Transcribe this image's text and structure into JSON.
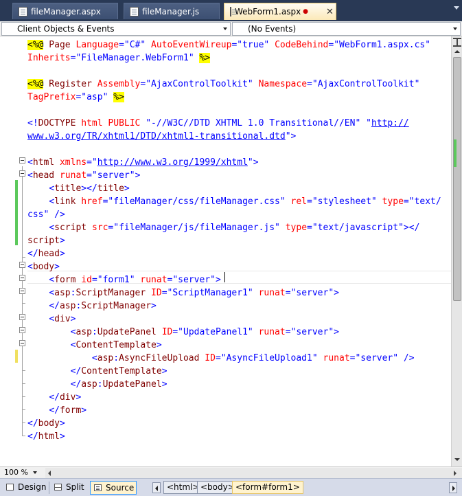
{
  "tabs": [
    {
      "label": "fileManager.aspx",
      "active": false
    },
    {
      "label": "fileManager.js",
      "active": false
    },
    {
      "label": "WebForm1.aspx",
      "active": true,
      "dirty_marker": "●",
      "close": "✕"
    }
  ],
  "navbar": {
    "objects_combo": "Client Objects & Events",
    "events_combo": "(No Events)"
  },
  "code_lines": [
    {
      "segs": [
        {
          "t": "<%@",
          "c": "dir"
        },
        {
          "t": " Page ",
          "c": "asp"
        },
        {
          "t": "Language",
          "c": "attr"
        },
        {
          "t": "=",
          "c": "blue"
        },
        {
          "t": "\"C#\"",
          "c": "val"
        },
        {
          "t": " ",
          "c": ""
        },
        {
          "t": "AutoEventWireup",
          "c": "attr"
        },
        {
          "t": "=",
          "c": "blue"
        },
        {
          "t": "\"true\"",
          "c": "val"
        },
        {
          "t": " ",
          "c": ""
        },
        {
          "t": "CodeBehind",
          "c": "attr"
        },
        {
          "t": "=",
          "c": "blue"
        },
        {
          "t": "\"WebForm1.aspx.cs\"",
          "c": "val"
        }
      ]
    },
    {
      "segs": [
        {
          "t": "Inherits",
          "c": "attr"
        },
        {
          "t": "=",
          "c": "blue"
        },
        {
          "t": "\"FileManager.WebForm1\"",
          "c": "val"
        },
        {
          "t": " ",
          "c": ""
        },
        {
          "t": "%>",
          "c": "dir"
        }
      ]
    },
    {
      "segs": []
    },
    {
      "segs": [
        {
          "t": "<%@",
          "c": "dir"
        },
        {
          "t": " Register ",
          "c": "asp"
        },
        {
          "t": "Assembly",
          "c": "attr"
        },
        {
          "t": "=",
          "c": "blue"
        },
        {
          "t": "\"AjaxControlToolkit\"",
          "c": "val"
        },
        {
          "t": " ",
          "c": ""
        },
        {
          "t": "Namespace",
          "c": "attr"
        },
        {
          "t": "=",
          "c": "blue"
        },
        {
          "t": "\"AjaxControlToolkit\"",
          "c": "val"
        }
      ]
    },
    {
      "segs": [
        {
          "t": "TagPrefix",
          "c": "attr"
        },
        {
          "t": "=",
          "c": "blue"
        },
        {
          "t": "\"asp\"",
          "c": "val"
        },
        {
          "t": " ",
          "c": ""
        },
        {
          "t": "%>",
          "c": "dir"
        }
      ]
    },
    {
      "segs": []
    },
    {
      "segs": [
        {
          "t": "<!",
          "c": "blue"
        },
        {
          "t": "DOCTYPE",
          "c": "asp"
        },
        {
          "t": " ",
          "c": ""
        },
        {
          "t": "html",
          "c": "attr"
        },
        {
          "t": " ",
          "c": ""
        },
        {
          "t": "PUBLIC",
          "c": "attr"
        },
        {
          "t": " ",
          "c": ""
        },
        {
          "t": "\"-//W3C//DTD XHTML 1.0 Transitional//EN\"",
          "c": "val"
        },
        {
          "t": " ",
          "c": ""
        },
        {
          "t": "\"",
          "c": "val"
        },
        {
          "t": "http://",
          "c": "link"
        }
      ]
    },
    {
      "segs": [
        {
          "t": "www.w3.org/TR/xhtml1/DTD/xhtml1-transitional.dtd",
          "c": "link"
        },
        {
          "t": "\"",
          "c": "val"
        },
        {
          "t": ">",
          "c": "blue"
        }
      ]
    },
    {
      "segs": []
    },
    {
      "segs": [
        {
          "t": "<",
          "c": "blue"
        },
        {
          "t": "html",
          "c": "asp"
        },
        {
          "t": " ",
          "c": ""
        },
        {
          "t": "xmlns",
          "c": "attr"
        },
        {
          "t": "=",
          "c": "blue"
        },
        {
          "t": "\"",
          "c": "val"
        },
        {
          "t": "http://www.w3.org/1999/xhtml",
          "c": "link"
        },
        {
          "t": "\"",
          "c": "val"
        },
        {
          "t": ">",
          "c": "blue"
        }
      ]
    },
    {
      "segs": [
        {
          "t": "<",
          "c": "blue"
        },
        {
          "t": "head",
          "c": "asp"
        },
        {
          "t": " ",
          "c": ""
        },
        {
          "t": "runat",
          "c": "attr"
        },
        {
          "t": "=",
          "c": "blue"
        },
        {
          "t": "\"server\"",
          "c": "val"
        },
        {
          "t": ">",
          "c": "blue"
        }
      ]
    },
    {
      "segs": [
        {
          "t": "    ",
          "c": ""
        },
        {
          "t": "<",
          "c": "blue"
        },
        {
          "t": "title",
          "c": "asp"
        },
        {
          "t": "></",
          "c": "blue"
        },
        {
          "t": "title",
          "c": "asp"
        },
        {
          "t": ">",
          "c": "blue"
        }
      ]
    },
    {
      "segs": [
        {
          "t": "    ",
          "c": ""
        },
        {
          "t": "<",
          "c": "blue"
        },
        {
          "t": "link",
          "c": "asp"
        },
        {
          "t": " ",
          "c": ""
        },
        {
          "t": "href",
          "c": "attr"
        },
        {
          "t": "=",
          "c": "blue"
        },
        {
          "t": "\"fileManager/css/fileManager.css\"",
          "c": "val"
        },
        {
          "t": " ",
          "c": ""
        },
        {
          "t": "rel",
          "c": "attr"
        },
        {
          "t": "=",
          "c": "blue"
        },
        {
          "t": "\"stylesheet\"",
          "c": "val"
        },
        {
          "t": " ",
          "c": ""
        },
        {
          "t": "type",
          "c": "attr"
        },
        {
          "t": "=",
          "c": "blue"
        },
        {
          "t": "\"text/",
          "c": "val"
        }
      ]
    },
    {
      "segs": [
        {
          "t": "css\"",
          "c": "val"
        },
        {
          "t": " />",
          "c": "blue"
        }
      ]
    },
    {
      "segs": [
        {
          "t": "    ",
          "c": ""
        },
        {
          "t": "<",
          "c": "blue"
        },
        {
          "t": "script",
          "c": "asp"
        },
        {
          "t": " ",
          "c": ""
        },
        {
          "t": "src",
          "c": "attr"
        },
        {
          "t": "=",
          "c": "blue"
        },
        {
          "t": "\"fileManager/js/fileManager.js\"",
          "c": "val"
        },
        {
          "t": " ",
          "c": ""
        },
        {
          "t": "type",
          "c": "attr"
        },
        {
          "t": "=",
          "c": "blue"
        },
        {
          "t": "\"text/javascript\"",
          "c": "val"
        },
        {
          "t": "></",
          "c": "blue"
        }
      ]
    },
    {
      "segs": [
        {
          "t": "script",
          "c": "asp"
        },
        {
          "t": ">",
          "c": "blue"
        }
      ]
    },
    {
      "segs": [
        {
          "t": "</",
          "c": "blue"
        },
        {
          "t": "head",
          "c": "asp"
        },
        {
          "t": ">",
          "c": "blue"
        }
      ]
    },
    {
      "segs": [
        {
          "t": "<",
          "c": "blue"
        },
        {
          "t": "body",
          "c": "asp"
        },
        {
          "t": ">",
          "c": "blue"
        }
      ]
    },
    {
      "segs": [
        {
          "t": "    ",
          "c": ""
        },
        {
          "t": "<",
          "c": "blue"
        },
        {
          "t": "form",
          "c": "asp"
        },
        {
          "t": " ",
          "c": ""
        },
        {
          "t": "id",
          "c": "attr"
        },
        {
          "t": "=",
          "c": "blue"
        },
        {
          "t": "\"form1\"",
          "c": "val"
        },
        {
          "t": " ",
          "c": ""
        },
        {
          "t": "runat",
          "c": "attr"
        },
        {
          "t": "=",
          "c": "blue"
        },
        {
          "t": "\"server\"",
          "c": "val"
        },
        {
          "t": ">",
          "c": "blue"
        }
      ]
    },
    {
      "segs": [
        {
          "t": "    ",
          "c": ""
        },
        {
          "t": "<",
          "c": "blue"
        },
        {
          "t": "asp",
          "c": "asp"
        },
        {
          "t": ":",
          "c": "blue"
        },
        {
          "t": "ScriptManager",
          "c": "asp"
        },
        {
          "t": " ",
          "c": ""
        },
        {
          "t": "ID",
          "c": "attr"
        },
        {
          "t": "=",
          "c": "blue"
        },
        {
          "t": "\"ScriptManager1\"",
          "c": "val"
        },
        {
          "t": " ",
          "c": ""
        },
        {
          "t": "runat",
          "c": "attr"
        },
        {
          "t": "=",
          "c": "blue"
        },
        {
          "t": "\"server\"",
          "c": "val"
        },
        {
          "t": ">",
          "c": "blue"
        }
      ]
    },
    {
      "segs": [
        {
          "t": "    ",
          "c": ""
        },
        {
          "t": "</",
          "c": "blue"
        },
        {
          "t": "asp",
          "c": "asp"
        },
        {
          "t": ":",
          "c": "blue"
        },
        {
          "t": "ScriptManager",
          "c": "asp"
        },
        {
          "t": ">",
          "c": "blue"
        }
      ]
    },
    {
      "segs": [
        {
          "t": "    ",
          "c": ""
        },
        {
          "t": "<",
          "c": "blue"
        },
        {
          "t": "div",
          "c": "asp"
        },
        {
          "t": ">",
          "c": "blue"
        }
      ]
    },
    {
      "segs": [
        {
          "t": "        ",
          "c": ""
        },
        {
          "t": "<",
          "c": "blue"
        },
        {
          "t": "asp",
          "c": "asp"
        },
        {
          "t": ":",
          "c": "blue"
        },
        {
          "t": "UpdatePanel",
          "c": "asp"
        },
        {
          "t": " ",
          "c": ""
        },
        {
          "t": "ID",
          "c": "attr"
        },
        {
          "t": "=",
          "c": "blue"
        },
        {
          "t": "\"UpdatePanel1\"",
          "c": "val"
        },
        {
          "t": " ",
          "c": ""
        },
        {
          "t": "runat",
          "c": "attr"
        },
        {
          "t": "=",
          "c": "blue"
        },
        {
          "t": "\"server\"",
          "c": "val"
        },
        {
          "t": ">",
          "c": "blue"
        }
      ]
    },
    {
      "segs": [
        {
          "t": "        ",
          "c": ""
        },
        {
          "t": "<",
          "c": "blue"
        },
        {
          "t": "ContentTemplate",
          "c": "asp"
        },
        {
          "t": ">",
          "c": "blue"
        }
      ]
    },
    {
      "segs": [
        {
          "t": "            ",
          "c": ""
        },
        {
          "t": "<",
          "c": "blue"
        },
        {
          "t": "asp",
          "c": "asp"
        },
        {
          "t": ":",
          "c": "blue"
        },
        {
          "t": "AsyncFileUpload",
          "c": "asp"
        },
        {
          "t": " ",
          "c": ""
        },
        {
          "t": "ID",
          "c": "attr"
        },
        {
          "t": "=",
          "c": "blue"
        },
        {
          "t": "\"AsyncFileUpload1\"",
          "c": "val"
        },
        {
          "t": " ",
          "c": ""
        },
        {
          "t": "runat",
          "c": "attr"
        },
        {
          "t": "=",
          "c": "blue"
        },
        {
          "t": "\"server\"",
          "c": "val"
        },
        {
          "t": " />",
          "c": "blue"
        }
      ]
    },
    {
      "segs": [
        {
          "t": "        ",
          "c": ""
        },
        {
          "t": "</",
          "c": "blue"
        },
        {
          "t": "ContentTemplate",
          "c": "asp"
        },
        {
          "t": ">",
          "c": "blue"
        }
      ]
    },
    {
      "segs": [
        {
          "t": "        ",
          "c": ""
        },
        {
          "t": "</",
          "c": "blue"
        },
        {
          "t": "asp",
          "c": "asp"
        },
        {
          "t": ":",
          "c": "blue"
        },
        {
          "t": "UpdatePanel",
          "c": "asp"
        },
        {
          "t": ">",
          "c": "blue"
        }
      ]
    },
    {
      "segs": [
        {
          "t": "    ",
          "c": ""
        },
        {
          "t": "</",
          "c": "blue"
        },
        {
          "t": "div",
          "c": "asp"
        },
        {
          "t": ">",
          "c": "blue"
        }
      ]
    },
    {
      "segs": [
        {
          "t": "    ",
          "c": ""
        },
        {
          "t": "</",
          "c": "blue"
        },
        {
          "t": "form",
          "c": "asp"
        },
        {
          "t": ">",
          "c": "blue"
        }
      ]
    },
    {
      "segs": [
        {
          "t": "</",
          "c": "blue"
        },
        {
          "t": "body",
          "c": "asp"
        },
        {
          "t": ">",
          "c": "blue"
        }
      ]
    },
    {
      "segs": [
        {
          "t": "</",
          "c": "blue"
        },
        {
          "t": "html",
          "c": "asp"
        },
        {
          "t": ">",
          "c": "blue"
        }
      ]
    }
  ],
  "zoom": {
    "value": "100 %"
  },
  "view_buttons": {
    "design": "Design",
    "split": "Split",
    "source": "Source"
  },
  "breadcrumbs": [
    "<html>",
    "<body>",
    "<form#form1>"
  ],
  "colors": {
    "tag_bracket": "#0000ff",
    "element_name": "#800000",
    "attribute": "#ff0000",
    "value": "#0000ff",
    "directive_highlight": "#ffff00",
    "change_bar_saved": "#5cc95c",
    "change_bar_unsaved": "#f0e060"
  }
}
